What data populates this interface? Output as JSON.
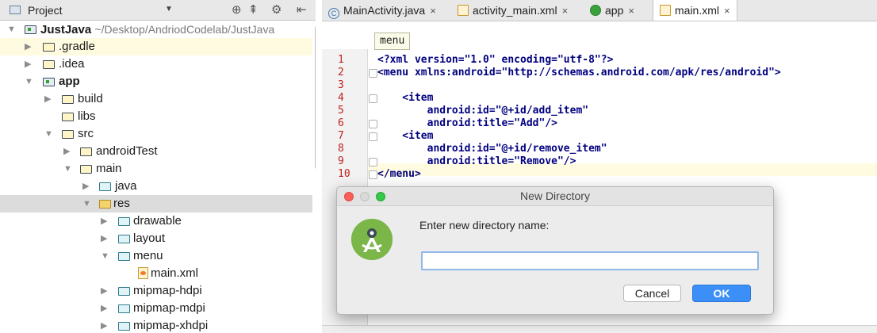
{
  "project_panel": {
    "title": "Project",
    "dropdown_icon": "caret-down",
    "tools": [
      "crosshair-icon",
      "collapse-icon",
      "gear-icon",
      "hide-icon"
    ],
    "tree": [
      {
        "label": "JustJava",
        "sub": "~/Desktop/AndriodCodelab/JustJava",
        "bold": true,
        "icon": "module-folder",
        "expanded": true
      },
      {
        "label": ".gradle",
        "icon": "folder",
        "expanded": false,
        "highlight": "yellow"
      },
      {
        "label": ".idea",
        "icon": "folder",
        "expanded": false
      },
      {
        "label": "app",
        "bold": true,
        "icon": "module-folder",
        "expanded": true
      },
      {
        "label": "build",
        "icon": "folder",
        "expanded": false
      },
      {
        "label": "libs",
        "icon": "folder"
      },
      {
        "label": "src",
        "icon": "folder",
        "expanded": true
      },
      {
        "label": "androidTest",
        "icon": "folder",
        "expanded": false
      },
      {
        "label": "main",
        "icon": "folder",
        "expanded": true
      },
      {
        "label": "java",
        "icon": "source-folder",
        "expanded": false
      },
      {
        "label": "res",
        "icon": "res-folder",
        "expanded": true,
        "highlight": "gray"
      },
      {
        "label": "drawable",
        "icon": "package-folder",
        "expanded": false
      },
      {
        "label": "layout",
        "icon": "package-folder",
        "expanded": false
      },
      {
        "label": "menu",
        "icon": "package-folder",
        "expanded": true
      },
      {
        "label": "main.xml",
        "icon": "xml-file"
      },
      {
        "label": "mipmap-hdpi",
        "icon": "package-folder",
        "expanded": false
      },
      {
        "label": "mipmap-mdpi",
        "icon": "package-folder",
        "expanded": false
      },
      {
        "label": "mipmap-xhdpi",
        "icon": "package-folder",
        "expanded": false
      }
    ]
  },
  "editor": {
    "tabs": [
      {
        "label": "MainActivity.java",
        "icon": "class-icon",
        "active": false
      },
      {
        "label": "activity_main.xml",
        "icon": "xml-icon",
        "active": false
      },
      {
        "label": "app",
        "icon": "android-app-icon",
        "active": false
      },
      {
        "label": "main.xml",
        "icon": "xml-icon",
        "active": true
      }
    ],
    "close_glyph": "×",
    "breadcrumb": "menu",
    "lines": [
      {
        "n": "1",
        "text": "<?xml version=\"1.0\" encoding=\"utf-8\"?>"
      },
      {
        "n": "2",
        "text": "<menu xmlns:android=\"http://schemas.android.com/apk/res/android\">"
      },
      {
        "n": "3",
        "text": ""
      },
      {
        "n": "4",
        "text": "    <item"
      },
      {
        "n": "5",
        "text": "        android:id=\"@+id/add_item\""
      },
      {
        "n": "6",
        "text": "        android:title=\"Add\"/>"
      },
      {
        "n": "7",
        "text": "    <item"
      },
      {
        "n": "8",
        "text": "        android:id=\"@+id/remove_item\""
      },
      {
        "n": "9",
        "text": "        android:title=\"Remove\"/>"
      },
      {
        "n": "10",
        "text": "</menu>"
      }
    ]
  },
  "dialog": {
    "title": "New Directory",
    "prompt": "Enter new directory name:",
    "input_value": "",
    "cancel_label": "Cancel",
    "ok_label": "OK",
    "logo_icon": "android-studio-logo-icon"
  },
  "colors": {
    "accent_blue": "#3b8ff6",
    "row_highlight_yellow": "#fffbe0",
    "row_selected_gray": "#dcdcdc",
    "line_number_red": "#c02020",
    "traffic_red": "#fc5f57",
    "traffic_yellow": "#d9d9d9",
    "traffic_green": "#35c84a"
  }
}
